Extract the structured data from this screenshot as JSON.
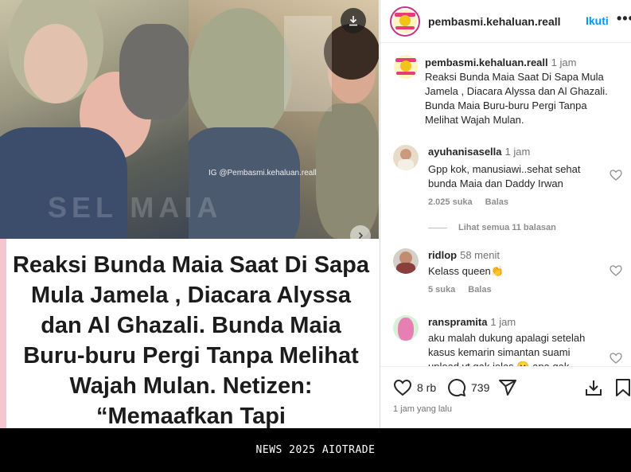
{
  "post": {
    "watermark_ig": "IG @Pembasmi.kehaluan.reall",
    "headline": "Reaksi Bunda Maia Saat Di Sapa Mula Jamela , Diacara Alyssa dan Al Ghazali. Bunda Maia Buru-buru Pergi Tanpa Melihat Wajah Mulan. Netizen: “Memaafkan Tapi"
  },
  "header": {
    "username": "pembasmi.kehaluan.reall",
    "follow_label": "Ikuti",
    "more_label": "•••"
  },
  "caption": {
    "username": "pembasmi.kehaluan.reall",
    "time": "1 jam",
    "text": "Reaksi Bunda Maia Saat Di Sapa Mula Jamela , Diacara Alyssa dan Al Ghazali. Bunda Maia Buru-buru Pergi Tanpa Melihat Wajah Mulan."
  },
  "comments": [
    {
      "username": "ayuhanisasella",
      "time": "1 jam",
      "text": "Gpp kok, manusiawi..sehat sehat bunda Maia dan Daddy Irwan",
      "likes": "2.025 suka",
      "reply": "Balas"
    },
    {
      "username": "ridlop",
      "time": "58 menit",
      "text": "Kelass queen👏",
      "likes": "5 suka",
      "reply": "Balas"
    },
    {
      "username": "ranspramita",
      "time": "1 jam",
      "text": "aku malah dukung apalagi setelah kasus kemarin simantan suami upload yt gak jelas 😐 apa gak"
    }
  ],
  "view_replies": "Lihat semua 11 balasan",
  "actions": {
    "likes_count": "8 rb",
    "comments_count": "739",
    "posted_time": "1 jam yang lalu"
  },
  "banner": {
    "text": "NEWS 2025 AIOTRADE"
  },
  "colors": {
    "accent": "#0095f6",
    "text": "#262626",
    "muted": "#737373",
    "banner_bg": "#000000"
  }
}
